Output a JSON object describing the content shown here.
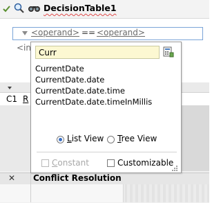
{
  "toolbar": {
    "title": "DecisionTable1",
    "icons": [
      "check-icon",
      "magnifier-icon",
      "binoculars-icon"
    ]
  },
  "condition": {
    "operand_left": "<operand>",
    "operator": "==",
    "operand_right": "<operand>",
    "second_row_text": "<in"
  },
  "rule_table": {
    "row_label": "C1",
    "row_text": "R"
  },
  "conflict_panel": {
    "title": "Conflict Resolution",
    "close_glyph": "✕"
  },
  "popup": {
    "search": {
      "value": "Curr",
      "placeholder": ""
    },
    "items": [
      "CurrentDate",
      "CurrentDate.date",
      "CurrentDate.date.time",
      "CurrentDate.date.timeInMillis"
    ],
    "view_mode": {
      "options": [
        "List View",
        "Tree View"
      ],
      "selected": "List View"
    },
    "constant_label": "Constant",
    "constant_checked": false,
    "constant_enabled": false,
    "customizable_label": "Customizable",
    "customizable_checked": false
  },
  "colors": {
    "search_bg": "#fcf8d2",
    "focus_border": "#7aa4d8",
    "radio_accent": "#3a6fc4"
  }
}
